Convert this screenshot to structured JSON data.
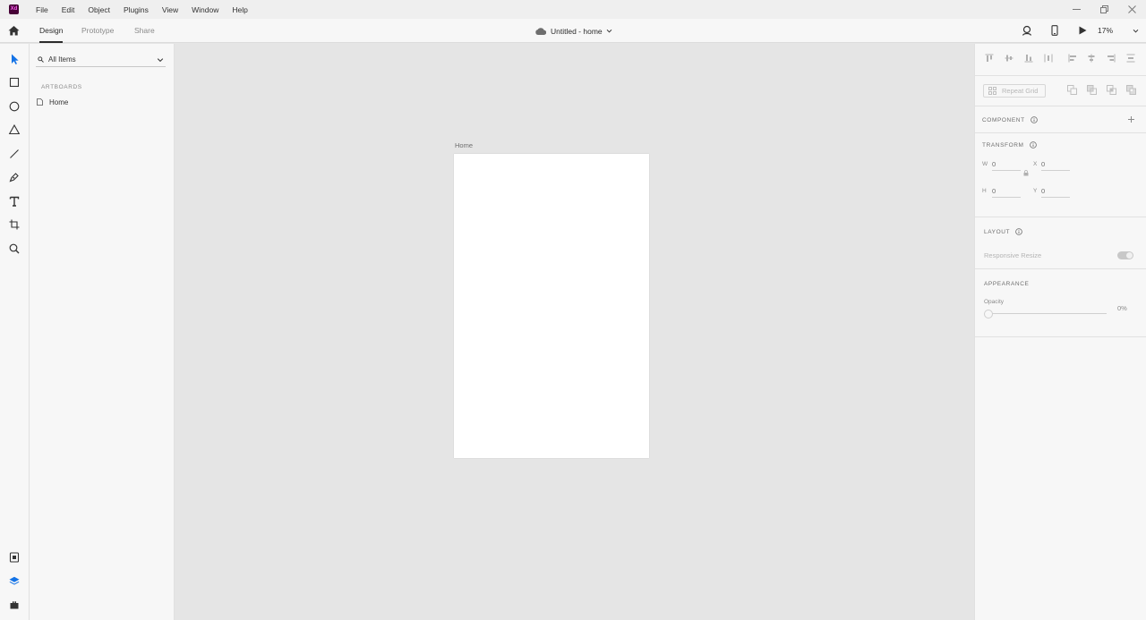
{
  "app": {
    "logo": "Xd"
  },
  "menu": [
    "File",
    "Edit",
    "Object",
    "Plugins",
    "View",
    "Window",
    "Help"
  ],
  "tabs": {
    "design": "Design",
    "prototype": "Prototype",
    "share": "Share"
  },
  "document": {
    "title": "Untitled - home"
  },
  "zoom": {
    "value": "17%"
  },
  "layers": {
    "filter_label": "All Items",
    "heading": "ARTBOARDS",
    "items": [
      "Home"
    ]
  },
  "canvas": {
    "artboard_name": "Home"
  },
  "inspector": {
    "repeat_grid": "Repeat Grid",
    "component_heading": "COMPONENT",
    "transform_heading": "TRANSFORM",
    "w_label": "W",
    "w_value": "0",
    "x_label": "X",
    "x_value": "0",
    "h_label": "H",
    "h_value": "0",
    "y_label": "Y",
    "y_value": "0",
    "layout_heading": "LAYOUT",
    "responsive_label": "Responsive Resize",
    "responsive_on": true,
    "appearance_heading": "APPEARANCE",
    "opacity_label": "Opacity",
    "opacity_value": "0%"
  },
  "colors": {
    "accent": "#1473e6",
    "logo_bg": "#470137",
    "logo_text": "#ff61f6"
  }
}
